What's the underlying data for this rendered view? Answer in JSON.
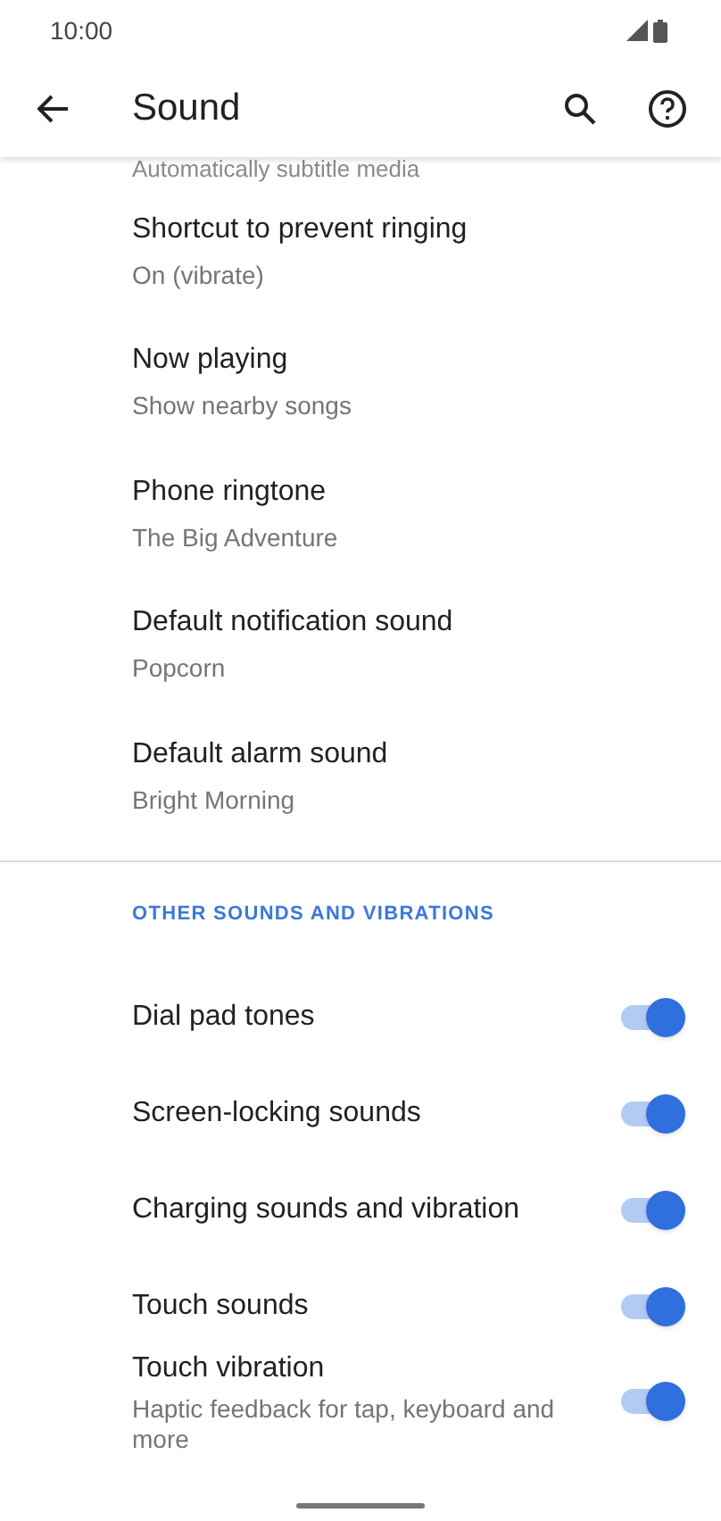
{
  "status_bar": {
    "time": "10:00"
  },
  "toolbar": {
    "title": "Sound"
  },
  "cut_subtitle": "Automatically subtitle media",
  "items": [
    {
      "title": "Shortcut to prevent ringing",
      "subtitle": "On (vibrate)"
    },
    {
      "title": "Now playing",
      "subtitle": "Show nearby songs"
    },
    {
      "title": "Phone ringtone",
      "subtitle": "The Big Adventure"
    },
    {
      "title": "Default notification sound",
      "subtitle": "Popcorn"
    },
    {
      "title": "Default alarm sound",
      "subtitle": "Bright Morning"
    }
  ],
  "section_header": "OTHER SOUNDS AND VIBRATIONS",
  "toggles": [
    {
      "title": "Dial pad tones",
      "on": true
    },
    {
      "title": "Screen-locking sounds",
      "on": true
    },
    {
      "title": "Charging sounds and vibration",
      "on": true
    },
    {
      "title": "Touch sounds",
      "on": true
    },
    {
      "title": "Touch vibration",
      "subtitle": "Haptic feedback for tap, keyboard and more",
      "on": true
    }
  ]
}
